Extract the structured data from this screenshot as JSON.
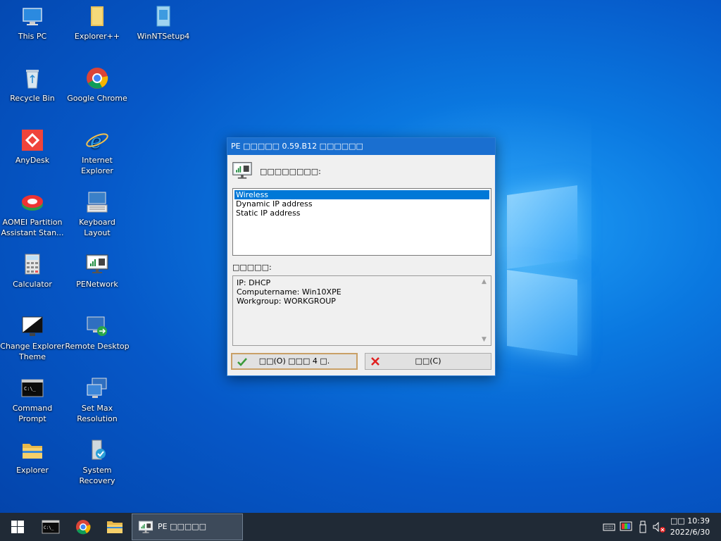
{
  "desktop": {
    "icons": [
      {
        "label": "This PC",
        "icon": "this-pc-icon"
      },
      {
        "label": "Explorer++",
        "icon": "folder-icon"
      },
      {
        "label": "WinNTSetup4",
        "icon": "winntsetup-icon"
      },
      {
        "label": "Recycle Bin",
        "icon": "recycle-bin-icon"
      },
      {
        "label": "Google Chrome",
        "icon": "chrome-icon"
      },
      {
        "label": "AnyDesk",
        "icon": "anydesk-icon"
      },
      {
        "label": "Internet Explorer",
        "icon": "internet-explorer-icon"
      },
      {
        "label": "AOMEI Partition Assistant Stan...",
        "icon": "aomei-icon"
      },
      {
        "label": "Keyboard Layout",
        "icon": "keyboard-icon"
      },
      {
        "label": "Calculator",
        "icon": "calculator-icon"
      },
      {
        "label": "PENetwork",
        "icon": "network-icon"
      },
      {
        "label": "Change Explorer Theme",
        "icon": "theme-icon"
      },
      {
        "label": "Remote Desktop",
        "icon": "remote-desktop-icon"
      },
      {
        "label": "Command Prompt",
        "icon": "command-prompt-icon"
      },
      {
        "label": "Set Max Resolution",
        "icon": "resolution-icon"
      },
      {
        "label": "Explorer",
        "icon": "folder-icon"
      },
      {
        "label": "System Recovery",
        "icon": "system-recovery-icon"
      }
    ]
  },
  "dialog": {
    "title": "PE □□□□□ 0.59.B12 □□□□□□",
    "select_label": "□□□□□□□□:",
    "options": [
      "Wireless",
      "Dynamic IP address",
      "Static IP address"
    ],
    "selected_option": "Wireless",
    "info_label": "□□□□□:",
    "info_lines": [
      "IP: DHCP",
      "Computername: Win10XPE",
      "Workgroup: WORKGROUP"
    ],
    "ok_button": "□□(O) □□□ 4 □.",
    "cancel_button": "□□(C)"
  },
  "taskbar": {
    "active_task": "PE □□□□□ 0.59.B12...",
    "clock_time": "□□ 10:39",
    "clock_date": "2022/6/30"
  },
  "colors": {
    "accent": "#0078d7",
    "titlebar": "#1a6fd0",
    "taskbar": "#202a36"
  }
}
